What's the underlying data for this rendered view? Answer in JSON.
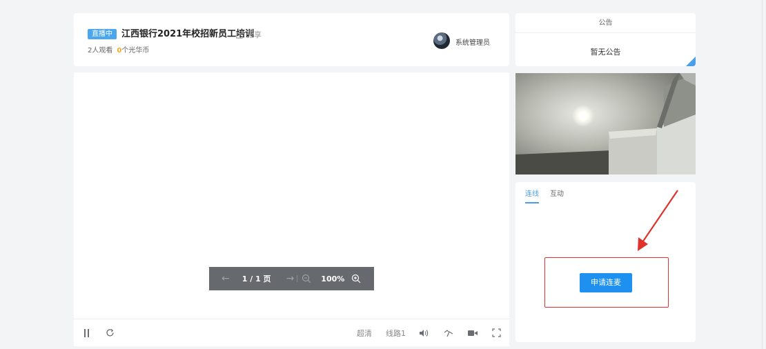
{
  "header": {
    "live_badge": "直播中",
    "title": "江西银行2021年校招新员工培训",
    "share": "分享",
    "viewers": "2人观看",
    "coins_value": "0",
    "coins_unit": "个光华币",
    "admin_name": "系统管理员"
  },
  "doc_toolbar": {
    "page": "1 / 1 页",
    "zoom": "100%"
  },
  "player": {
    "quality": "超清",
    "line": "线路1"
  },
  "notice": {
    "title": "公告",
    "content": "暂无公告"
  },
  "interact": {
    "tabs": [
      "连线",
      "互动"
    ],
    "active_tab": "连线",
    "apply_button": "申请连麦"
  },
  "colors": {
    "accent": "#1e90f0",
    "badge": "#4aa7ee",
    "highlight": "#e0322c",
    "coins": "#f5a623"
  }
}
